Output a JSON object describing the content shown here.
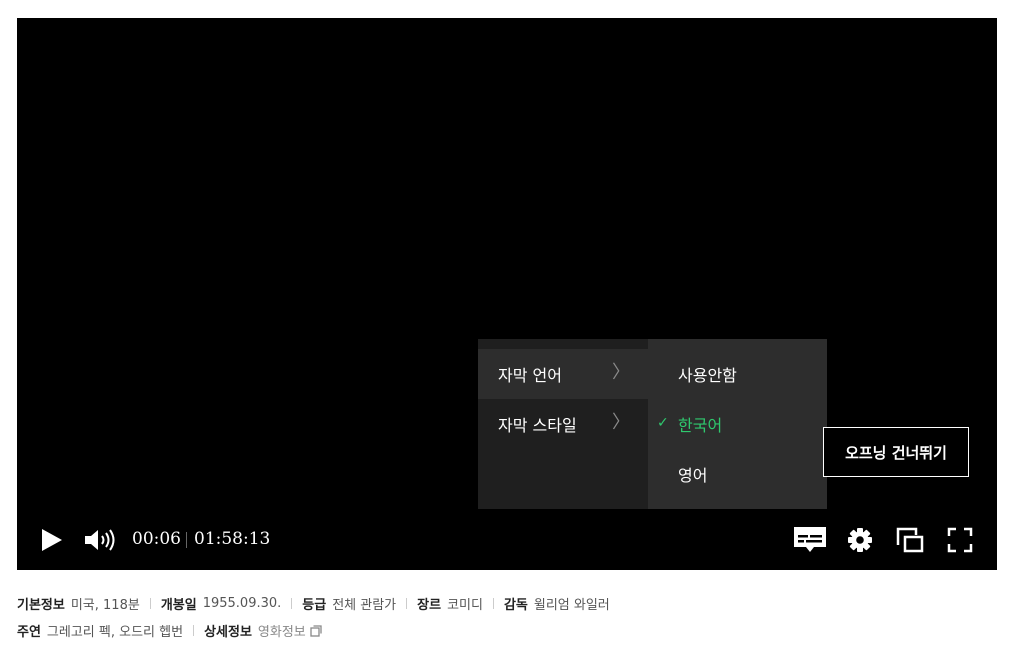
{
  "player": {
    "current_time": "00:06",
    "total_time": "01:58:13",
    "skip_opening_label": "오프닝 건너뛰기",
    "subtitle_menu": {
      "categories": [
        {
          "label": "자막 언어",
          "active": true
        },
        {
          "label": "자막 스타일",
          "active": false
        }
      ],
      "languages": [
        {
          "label": "사용안함",
          "selected": false
        },
        {
          "label": "한국어",
          "selected": true
        },
        {
          "label": "영어",
          "selected": false
        }
      ],
      "check_glyph": "✓",
      "chevron_glyph": "〉"
    },
    "icons": [
      "play-icon",
      "volume-icon",
      "subtitle-icon",
      "settings-gear-icon",
      "pip-icon",
      "fullscreen-icon"
    ],
    "colors": {
      "accent_selected": "#2fc96e",
      "menu_bg": "#1f1f1f",
      "submenu_bg": "#2d2d2d"
    }
  },
  "info": {
    "row1": [
      {
        "key": "기본정보",
        "value": "미국, 118분"
      },
      {
        "key": "개봉일",
        "value": "1955.09.30."
      },
      {
        "key": "등급",
        "value": "전체 관람가"
      },
      {
        "key": "장르",
        "value": "코미디"
      },
      {
        "key": "감독",
        "value": "윌리엄 와일러"
      }
    ],
    "row2": [
      {
        "key": "주연",
        "value": "그레고리 펙, 오드리 헵번"
      },
      {
        "key": "상세정보",
        "value": "영화정보"
      }
    ]
  }
}
